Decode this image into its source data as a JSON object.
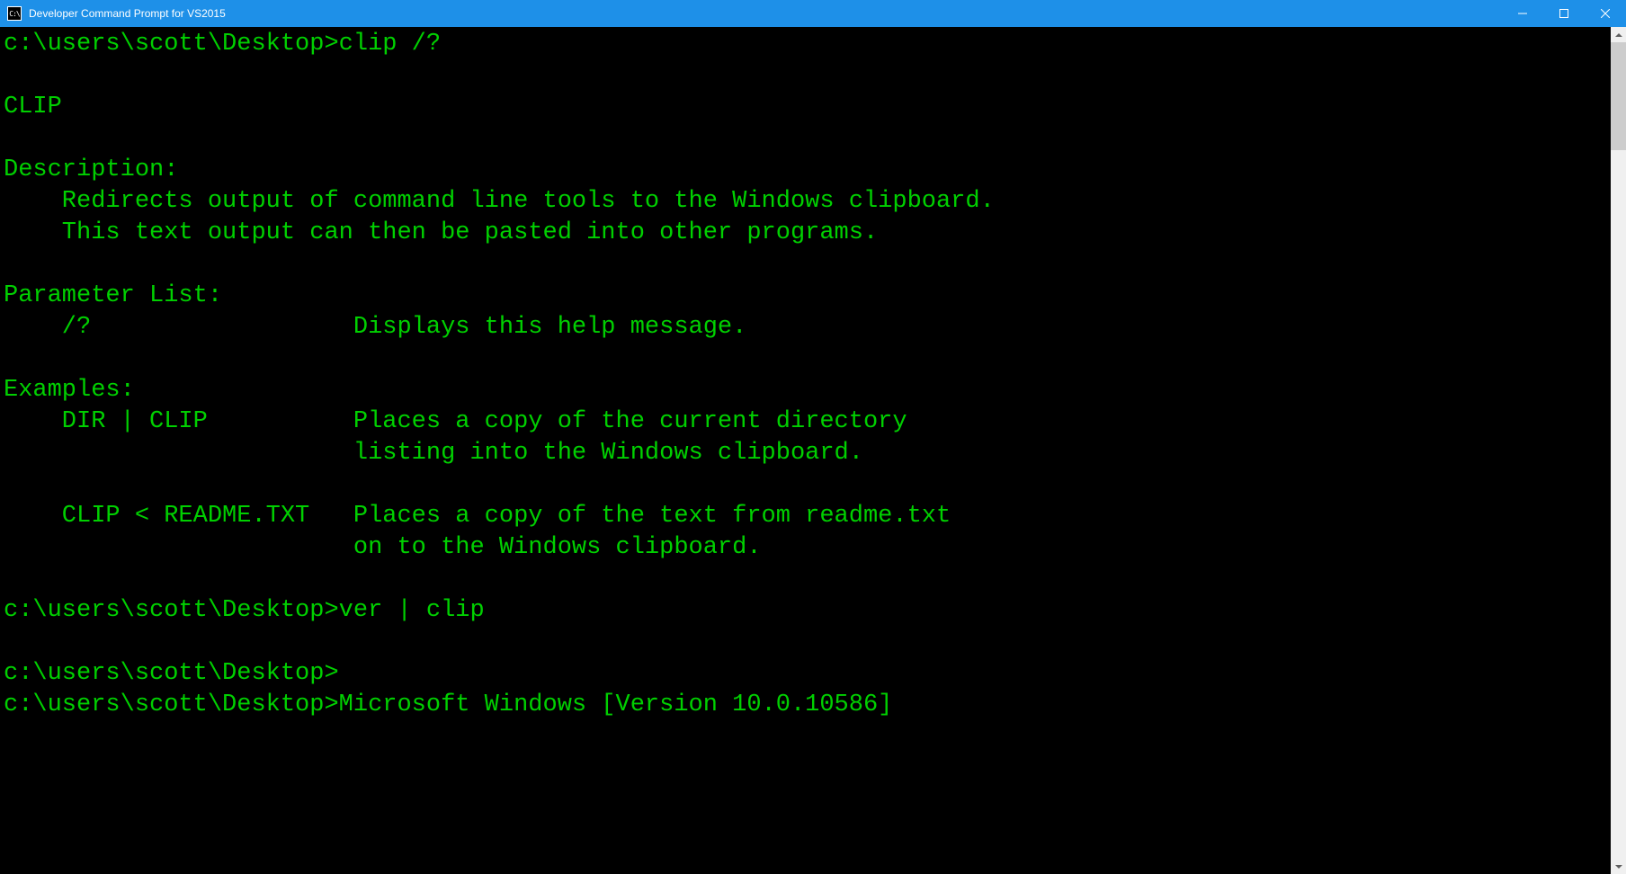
{
  "titlebar": {
    "icon_text": "C:\\",
    "title": "Developer Command Prompt for VS2015"
  },
  "terminal": {
    "lines": [
      "c:\\users\\scott\\Desktop>clip /?",
      "",
      "CLIP",
      "",
      "Description:",
      "    Redirects output of command line tools to the Windows clipboard.",
      "    This text output can then be pasted into other programs.",
      "",
      "Parameter List:",
      "    /?                  Displays this help message.",
      "",
      "Examples:",
      "    DIR | CLIP          Places a copy of the current directory",
      "                        listing into the Windows clipboard.",
      "",
      "    CLIP < README.TXT   Places a copy of the text from readme.txt",
      "                        on to the Windows clipboard.",
      "",
      "c:\\users\\scott\\Desktop>ver | clip",
      "",
      "c:\\users\\scott\\Desktop>",
      "c:\\users\\scott\\Desktop>Microsoft Windows [Version 10.0.10586]"
    ]
  }
}
